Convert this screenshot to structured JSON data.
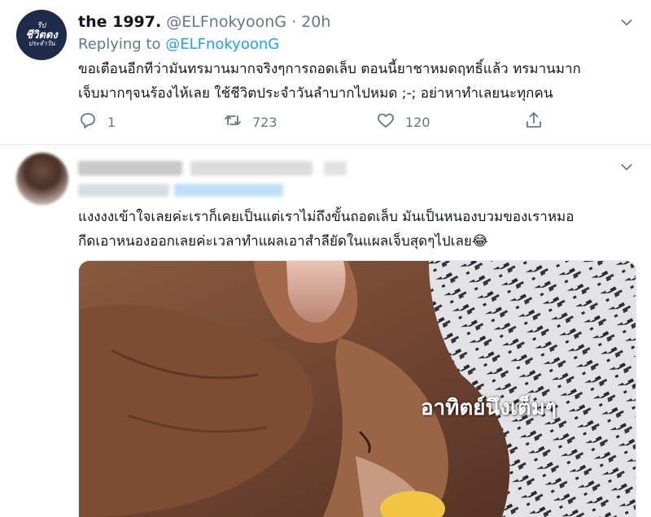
{
  "tweet1": {
    "display_name": "the 1997.",
    "handle": "@ELFnokyoonG",
    "separator": "·",
    "time": "20h",
    "replying_prefix": "Replying to",
    "replying_handle": "@ELFnokyoonG",
    "text_line1": "ขอเตือนอีกทีว่ามันทรมานมากจริงๆการถอดเล็บ ตอนนี้ยาชาหมดฤทธิ์แล้ว ทรมานมาก",
    "text_line2": "เจ็บมากๆจนร้องไห้เลย ใช้ชีวิตประจำวันลำบากไปหมด ;-; อย่าหาทำเลยนะทุกคน",
    "avatar_text": [
      "รีป",
      "ชีวิตตง",
      "ประจำวัน"
    ],
    "reply_count": "1",
    "retweet_count": "723",
    "like_count": "120",
    "icons": [
      "reply-icon",
      "retweet-icon",
      "like-icon",
      "share-icon",
      "chevron-down-icon"
    ]
  },
  "tweet2": {
    "text_line1": "แงงงงเข้าใจเลยค่ะเราก็เคยเป็นแต่เราไม่ถึงขั้นถอดเล็บ มันเป็นหนองบวมของเราหมอ",
    "text_line2": "กีดเอาหนองออกเลยค่ะเวลาทำแผลเอาสำลียัดในแผลเจ็บสุดๆไปเลย😂",
    "image_overlay_text": "อาทิตย์นึงเต็มๆ",
    "image_subject": "close-up photo of a finger with an injured nail",
    "author_blurred": true
  },
  "colors": {
    "link": "#1da1f2",
    "muted": "#657786",
    "text": "#14171a",
    "divider": "#e6ecf0"
  }
}
